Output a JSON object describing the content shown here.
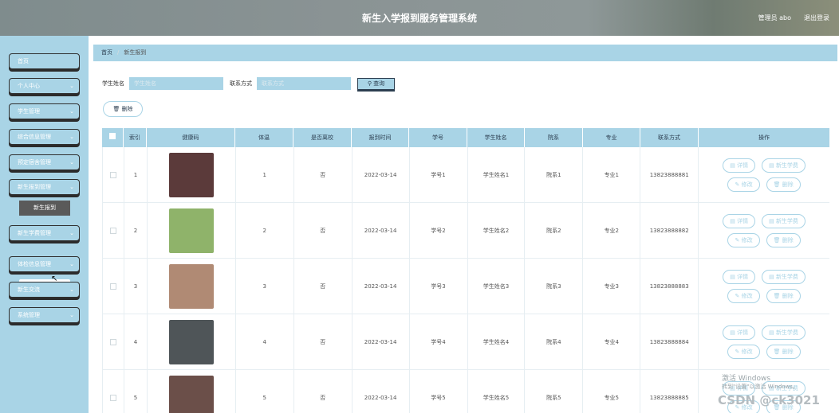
{
  "header": {
    "title": "新生入学报到服务管理系统",
    "user": "管理员 abo",
    "logout": "退出登录"
  },
  "sidebar": {
    "items": [
      {
        "label": "首页",
        "chevron": ""
      },
      {
        "label": "个人中心",
        "chevron": "⌄"
      },
      {
        "label": "学生管理",
        "chevron": "⌄"
      },
      {
        "label": "综合信息管理",
        "chevron": "⌄"
      },
      {
        "label": "预定宿舍管理",
        "chevron": "⌄"
      },
      {
        "label": "新生报到管理",
        "chevron": "⌄"
      },
      {
        "label": "新生学费管理",
        "chevron": "⌄"
      },
      {
        "label": "体检信息管理",
        "chevron": "⌄"
      },
      {
        "label": "新生交流",
        "chevron": "⌄"
      },
      {
        "label": "系统管理",
        "chevron": "⌄"
      }
    ],
    "submenu": "新生报到"
  },
  "breadcrumb": {
    "home": "首页",
    "current": "新生报到"
  },
  "search": {
    "name_label": "学生姓名",
    "name_placeholder": "学生姓名",
    "contact_label": "联系方式",
    "contact_placeholder": "联系方式",
    "button": "查询"
  },
  "actions": {
    "delete": "删除"
  },
  "table": {
    "headers": [
      "",
      "索引",
      "健康码",
      "体温",
      "是否离校",
      "报到时间",
      "学号",
      "学生姓名",
      "院系",
      "专业",
      "联系方式",
      "操作"
    ],
    "ops": {
      "detail": "详情",
      "pay": "新生学费",
      "edit": "修改",
      "delete": "删除"
    },
    "rows": [
      {
        "index": "1",
        "temp": "1",
        "left": "否",
        "date": "2022-03-14",
        "sid": "学号1",
        "name": "学生姓名1",
        "dept": "院系1",
        "major": "专业1",
        "phone": "13823888881",
        "photo_color": "#5b3a3a"
      },
      {
        "index": "2",
        "temp": "2",
        "left": "否",
        "date": "2022-03-14",
        "sid": "学号2",
        "name": "学生姓名2",
        "dept": "院系2",
        "major": "专业2",
        "phone": "13823888882",
        "photo_color": "#8fb36a"
      },
      {
        "index": "3",
        "temp": "3",
        "left": "否",
        "date": "2022-03-14",
        "sid": "学号3",
        "name": "学生姓名3",
        "dept": "院系3",
        "major": "专业3",
        "phone": "13823888883",
        "photo_color": "#b08a74"
      },
      {
        "index": "4",
        "temp": "4",
        "left": "否",
        "date": "2022-03-14",
        "sid": "学号4",
        "name": "学生姓名4",
        "dept": "院系4",
        "major": "专业4",
        "phone": "13823888884",
        "photo_color": "#4f5558"
      },
      {
        "index": "5",
        "temp": "5",
        "left": "否",
        "date": "2022-03-14",
        "sid": "学号5",
        "name": "学生姓名5",
        "dept": "院系5",
        "major": "专业5",
        "phone": "13823888885",
        "photo_color": "#6b4f49"
      }
    ]
  },
  "overlay": {
    "activate": "激活 Windows",
    "activate_hint": "转到\"设置\"以激活 Windows。",
    "csdn": "CSDN @ck3021"
  },
  "colors": {
    "accent": "#a9d4e6"
  }
}
